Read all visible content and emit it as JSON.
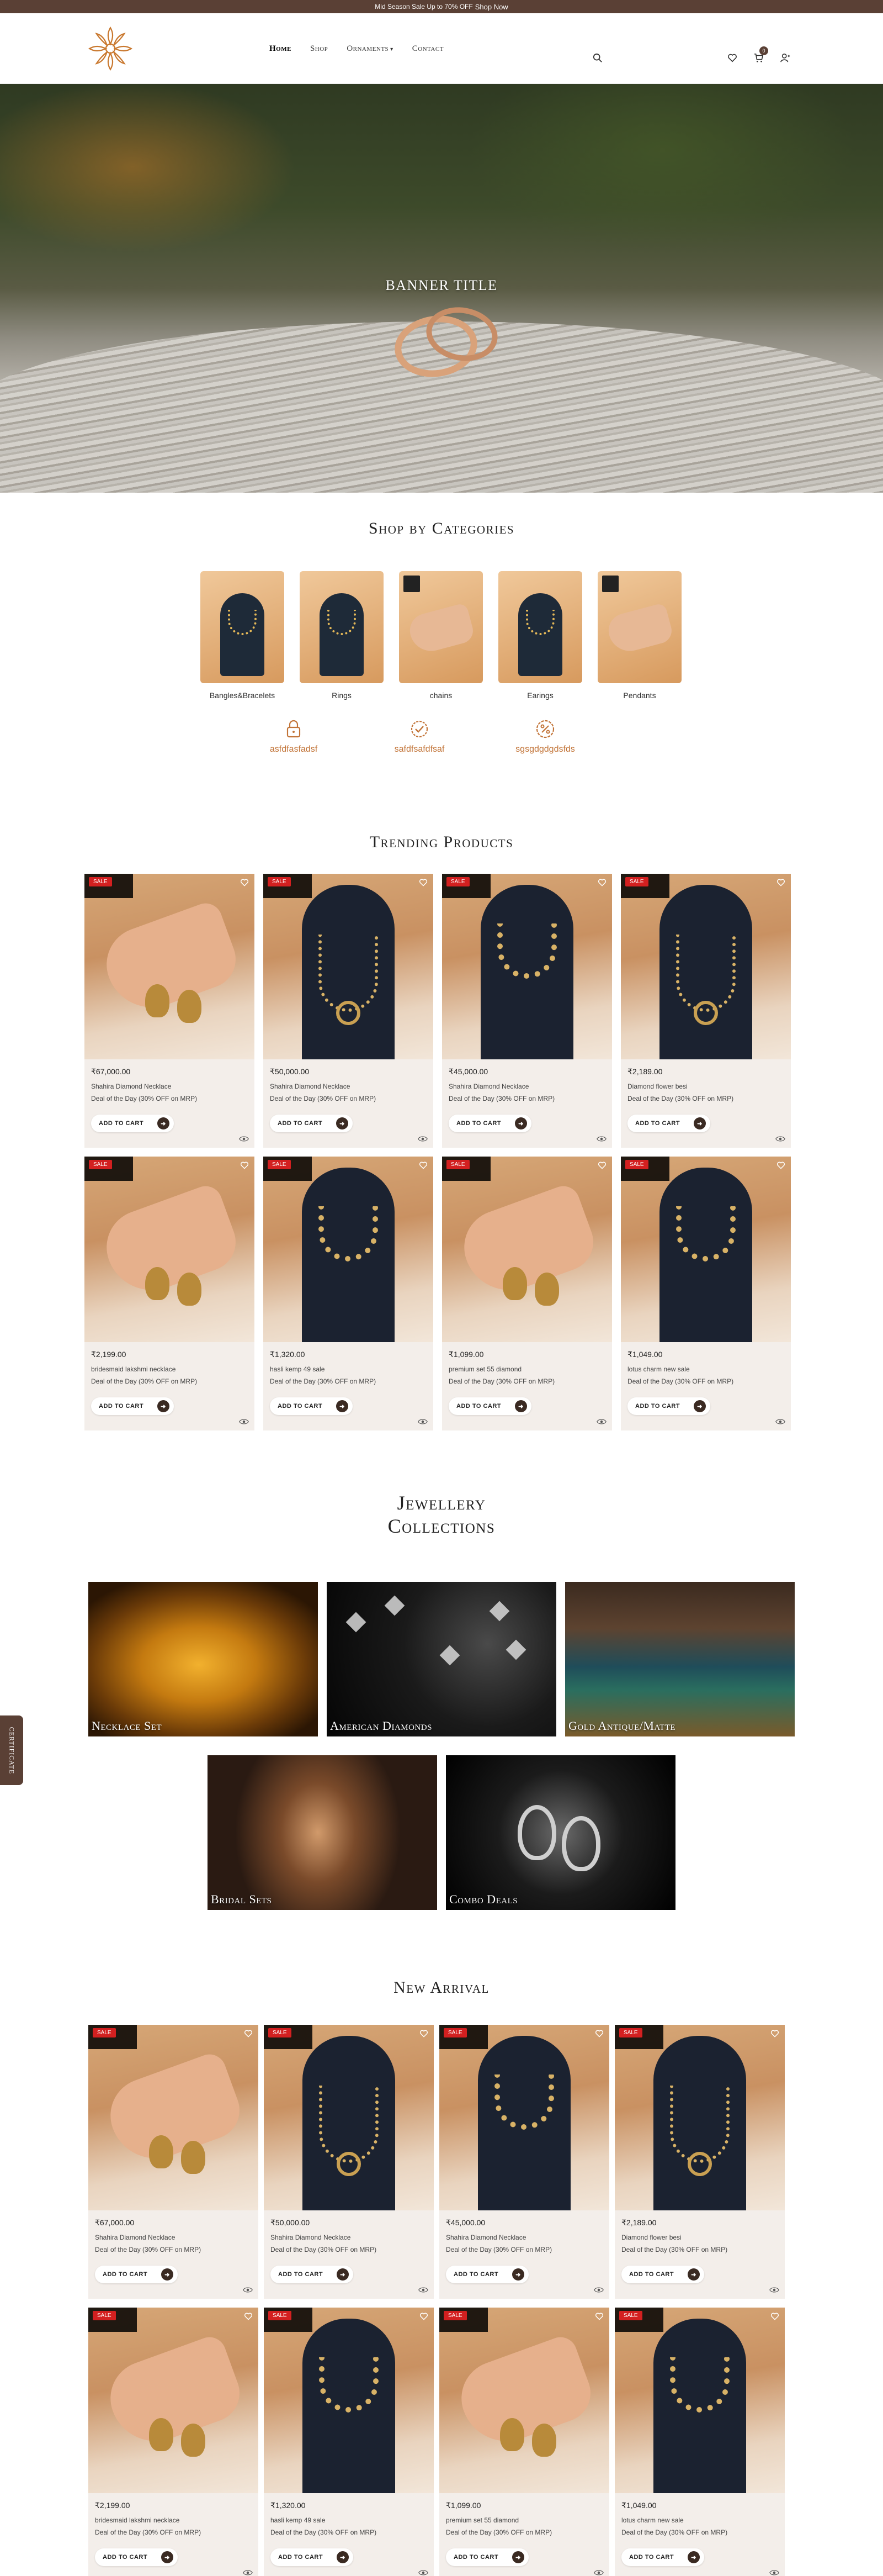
{
  "topbar": {
    "text": "Mid Season Sale Up to 70% OFF",
    "link": "Shop Now"
  },
  "nav": {
    "items": [
      {
        "label": "Home",
        "active": true
      },
      {
        "label": "Shop"
      },
      {
        "label": "Ornaments",
        "dropdown": true
      },
      {
        "label": "Contact"
      }
    ],
    "cart_count": "0"
  },
  "hero": {
    "title": "BANNER TITLE"
  },
  "categories": {
    "title": "Shop by Categories",
    "items": [
      {
        "label": "Bangles&Bracelets"
      },
      {
        "label": "Rings"
      },
      {
        "label": "chains"
      },
      {
        "label": "Earings"
      },
      {
        "label": "Pendants"
      }
    ]
  },
  "features": [
    {
      "label": "asfdfasfadsf",
      "icon": "lock-icon"
    },
    {
      "label": "safdfsafdfsaf",
      "icon": "badge-check-icon"
    },
    {
      "label": "sgsgdgdgdsfds",
      "icon": "discount-icon"
    }
  ],
  "trending": {
    "title": "Trending Products",
    "products": [
      {
        "price": "₹67,000.00",
        "name": "Shahira Diamond Necklace",
        "deal": "Deal of the Day (30% OFF on MRP)",
        "sale": "SALE",
        "cta": "ADD TO CART",
        "img": "earring-hand"
      },
      {
        "price": "₹50,000.00",
        "name": "Shahira Diamond Necklace",
        "deal": "Deal of the Day (30% OFF on MRP)",
        "sale": "SALE",
        "cta": "ADD TO CART",
        "img": "bust-pendant"
      },
      {
        "price": "₹45,000.00",
        "name": "Shahira Diamond Necklace",
        "deal": "Deal of the Day (30% OFF on MRP)",
        "sale": "SALE",
        "cta": "ADD TO CART",
        "img": "bust-set"
      },
      {
        "price": "₹2,189.00",
        "name": "Diamond flower besi",
        "deal": "Deal of the Day (30% OFF on MRP)",
        "sale": "SALE",
        "cta": "ADD TO CART",
        "img": "bust-pendant"
      },
      {
        "price": "₹2,199.00",
        "name": "bridesmaid lakshmi necklace",
        "deal": "Deal of the Day (30% OFF on MRP)",
        "sale": "SALE",
        "cta": "ADD TO CART",
        "img": "earring-hand"
      },
      {
        "price": "₹1,320.00",
        "name": "hasli kemp 49 sale",
        "deal": "Deal of the Day (30% OFF on MRP)",
        "sale": "SALE",
        "cta": "ADD TO CART",
        "img": "bust-set"
      },
      {
        "price": "₹1,099.00",
        "name": "premium set 55 diamond",
        "deal": "Deal of the Day (30% OFF on MRP)",
        "sale": "SALE",
        "cta": "ADD TO CART",
        "img": "earring-hand"
      },
      {
        "price": "₹1,049.00",
        "name": "lotus charm new sale",
        "deal": "Deal of the Day (30% OFF on MRP)",
        "sale": "SALE",
        "cta": "ADD TO CART",
        "img": "bust-set"
      }
    ]
  },
  "collections": {
    "title_line1": "Jewellery",
    "title_line2": "Collections",
    "items": [
      {
        "label": "Necklace Set"
      },
      {
        "label": "American Diamonds"
      },
      {
        "label": "Gold Antique/Matte"
      },
      {
        "label": "Bridal Sets"
      },
      {
        "label": "Combo Deals"
      }
    ]
  },
  "new_arrival": {
    "title": "New Arrival",
    "products": [
      {
        "price": "₹67,000.00",
        "name": "Shahira Diamond Necklace",
        "deal": "Deal of the Day (30% OFF on MRP)",
        "sale": "SALE",
        "cta": "ADD TO CART",
        "img": "earring-hand"
      },
      {
        "price": "₹50,000.00",
        "name": "Shahira Diamond Necklace",
        "deal": "Deal of the Day (30% OFF on MRP)",
        "sale": "SALE",
        "cta": "ADD TO CART",
        "img": "bust-pendant"
      },
      {
        "price": "₹45,000.00",
        "name": "Shahira Diamond Necklace",
        "deal": "Deal of the Day (30% OFF on MRP)",
        "sale": "SALE",
        "cta": "ADD TO CART",
        "img": "bust-set"
      },
      {
        "price": "₹2,189.00",
        "name": "Diamond flower besi",
        "deal": "Deal of the Day (30% OFF on MRP)",
        "sale": "SALE",
        "cta": "ADD TO CART",
        "img": "bust-pendant"
      },
      {
        "price": "₹2,199.00",
        "name": "bridesmaid lakshmi necklace",
        "deal": "Deal of the Day (30% OFF on MRP)",
        "sale": "SALE",
        "cta": "ADD TO CART",
        "img": "earring-hand"
      },
      {
        "price": "₹1,320.00",
        "name": "hasli kemp 49 sale",
        "deal": "Deal of the Day (30% OFF on MRP)",
        "sale": "SALE",
        "cta": "ADD TO CART",
        "img": "bust-set"
      },
      {
        "price": "₹1,099.00",
        "name": "premium set 55 diamond",
        "deal": "Deal of the Day (30% OFF on MRP)",
        "sale": "SALE",
        "cta": "ADD TO CART",
        "img": "earring-hand"
      },
      {
        "price": "₹1,049.00",
        "name": "lotus charm new sale",
        "deal": "Deal of the Day (30% OFF on MRP)",
        "sale": "SALE",
        "cta": "ADD TO CART",
        "img": "bust-set"
      }
    ]
  },
  "side_tab": {
    "label": "CERTIFICATE"
  },
  "colors": {
    "brand": "#5a4035",
    "accent": "#c27438",
    "sale": "#d32020",
    "card_bg": "#f3eeea"
  }
}
